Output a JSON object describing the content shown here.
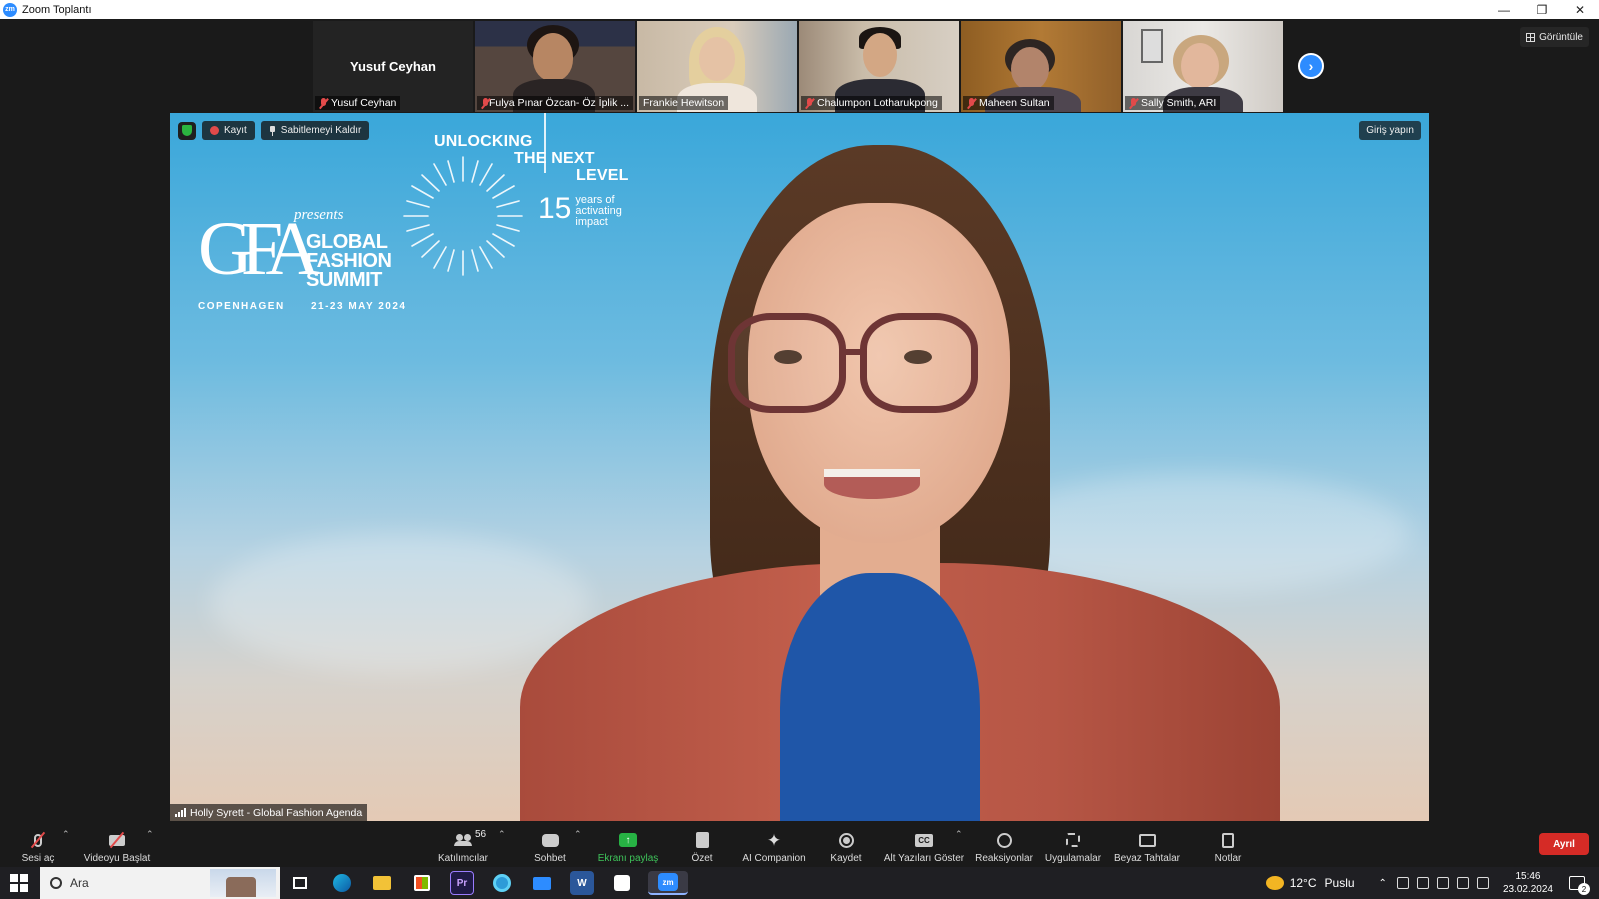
{
  "window": {
    "title": "Zoom Toplantı",
    "app_icon": "zm",
    "controls": [
      "minimize",
      "restore",
      "close"
    ]
  },
  "meeting": {
    "view_label": "Görüntüle",
    "next_page_icon": "chevron-right-icon",
    "thumbnails": [
      {
        "name": "Yusuf Ceyhan",
        "display_name": "Yusuf Ceyhan",
        "video": false,
        "muted": true
      },
      {
        "name": "Fulya Pınar Özcan- Öz İplik ...",
        "video": true,
        "muted": true
      },
      {
        "name": "Frankie Hewitson",
        "video": true,
        "muted": false
      },
      {
        "name": "Chalumpon Lotharukpong",
        "video": true,
        "muted": true
      },
      {
        "name": "Maheen Sultan",
        "video": true,
        "muted": true
      },
      {
        "name": "Sally Smith, ARI",
        "video": true,
        "muted": true
      }
    ],
    "main_video": {
      "record_label": "Kayıt",
      "unpin_label": "Sabitlemeyi Kaldır",
      "signin_label": "Giriş yapın",
      "speaker_label": "Holly Syrett - Global Fashion Agenda",
      "background": {
        "unlocking_line1": "UNLOCKING",
        "unlocking_line2": "THE NEXT",
        "unlocking_line3": "LEVEL",
        "years_number": "15",
        "years_text_1": "years of",
        "years_text_2": "activating",
        "years_text_3": "impact",
        "logo_letters": "GFA",
        "presents": "presents",
        "summit_line1": "GLOBAL",
        "summit_line2": "FASHION",
        "summit_line3": "SUMMIT",
        "city": "COPENHAGEN",
        "dates": "21-23 MAY 2024"
      }
    }
  },
  "toolbar": {
    "unmute": "Sesi aç",
    "start_video": "Videoyu Başlat",
    "participants": "Katılımcılar",
    "participant_count": "56",
    "chat": "Sohbet",
    "share_screen": "Ekranı paylaş",
    "summary": "Özet",
    "ai_companion": "AI Companion",
    "record": "Kaydet",
    "captions": "Alt Yazıları Göster",
    "cc": "CC",
    "reactions": "Reaksiyonlar",
    "apps": "Uygulamalar",
    "whiteboards": "Beyaz Tahtalar",
    "notes": "Notlar",
    "leave": "Ayrıl",
    "accent_green": "#3ec35a",
    "leave_color": "#d52b26"
  },
  "taskbar": {
    "search_placeholder": "Ara",
    "apps": [
      "task-view",
      "edge",
      "file-explorer",
      "store",
      "premiere",
      "browser",
      "mail",
      "word",
      "app",
      "zoom"
    ],
    "premiere_label": "Pr",
    "word_label": "W",
    "zoom_label": "zm",
    "weather_temp": "12°C",
    "weather_text": "Puslu",
    "time": "15:46",
    "date": "23.02.2024",
    "notification_count": "2"
  }
}
